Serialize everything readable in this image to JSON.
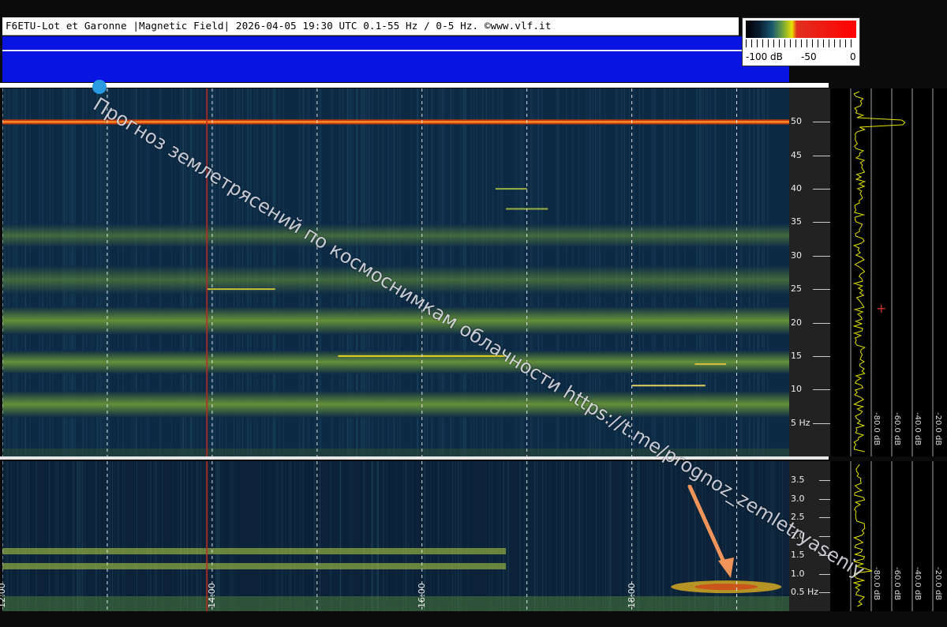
{
  "title": "F6ETU-Lot et Garonne |Magnetic Field| 2026-04-05 19:30 UTC 0.1-55 Hz / 0-5 Hz. ©www.vlf.it",
  "colorscale": {
    "labels": [
      "-100 dB",
      "-50",
      "0"
    ]
  },
  "watermark": "Прогноз землетрясений по космоснимкам облачности  https://t.me/prognoz_zemletryaseniy",
  "colors": {
    "background": "#0d2a45",
    "band": "#7fae3a",
    "hot": "#e02a10",
    "title_bar": "#ffffff",
    "blue_bar": "#0a14e0"
  },
  "chart_data": [
    {
      "type": "heatmap",
      "title": "F6ETU-Lot et Garonne |Magnetic Field| 2026-04-05 19:30 UTC 0.1-55 Hz / 0-5 Hz. ©www.vlf.it",
      "ylabel": "Hz",
      "y_ticks": [
        "50",
        "45",
        "40",
        "35",
        "30",
        "25",
        "20",
        "15",
        "10",
        "5 Hz"
      ],
      "y_tick_values": [
        50,
        45,
        40,
        35,
        30,
        25,
        20,
        15,
        10,
        5
      ],
      "ylim": [
        0,
        55
      ],
      "x_ticks": [
        "12:00",
        "14:00",
        "16:00",
        "18:00"
      ],
      "x_tick_values": [
        12,
        14,
        16,
        18
      ],
      "xlim": [
        12,
        19.5
      ],
      "horizontal_lines_hz": [
        {
          "freq": 50,
          "intensity": "high"
        },
        {
          "freq": 7.8,
          "intensity": "medium"
        },
        {
          "freq": 14.1,
          "intensity": "medium"
        },
        {
          "freq": 20.3,
          "intensity": "low"
        },
        {
          "freq": 26.4,
          "intensity": "low"
        }
      ],
      "vertical_line_time": 13.95,
      "spectrum_db_labels": [
        "-80.0 dB",
        "-60.0 dB",
        "-40.0 dB",
        "-20.0 dB"
      ]
    },
    {
      "type": "heatmap",
      "ylabel": "Hz",
      "y_ticks": [
        "3.5",
        "3.0",
        "2.5",
        "2.0",
        "1.5",
        "1.0",
        "0.5 Hz"
      ],
      "y_tick_values": [
        3.5,
        3.0,
        2.5,
        2.0,
        1.5,
        1.0,
        0.5
      ],
      "ylim": [
        0,
        4
      ],
      "x_ticks": [
        "12:00",
        "14:00",
        "16:00",
        "18:00"
      ],
      "x_tick_values": [
        12,
        14,
        16,
        18
      ],
      "xlim": [
        12,
        19.5
      ],
      "spectrum_db_labels": [
        "-80.0 dB",
        "-60.0 dB",
        "-40.0 dB",
        "-20.0 dB"
      ]
    }
  ]
}
